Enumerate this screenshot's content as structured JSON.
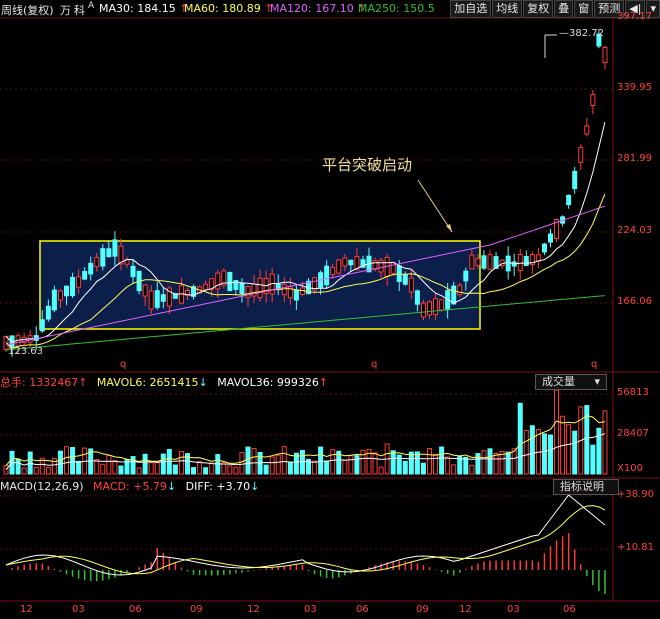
{
  "topbar": {
    "period_label": "周线(复权)",
    "wan_label": "万",
    "ke_label": "科",
    "a_label": "A",
    "ma30": "MA30: 184.15",
    "ma60": "MA60: 180.89",
    "ma120": "MA120: 167.10",
    "ma250": "MA250: 150.5",
    "buttons": [
      "加自选",
      "均线",
      "复权",
      "叠",
      "窗",
      "预测"
    ],
    "arrow_label": "◀|",
    "dropdown_label": "▾"
  },
  "annotation": {
    "text": "平台突破启动"
  },
  "price_axis": {
    "ticks": [
      "397.17",
      "339.95",
      "281.99",
      "224.03",
      "166.06"
    ]
  },
  "price_marks": {
    "high": "382.72",
    "low": "123.63",
    "q_markers": [
      "q",
      "q",
      "q"
    ]
  },
  "volume_panel": {
    "total_label": "总手: 1332467",
    "mavol6": "MAVOL6: 2651415",
    "mavol36": "MAVOL36: 999326",
    "button": "成交量",
    "ticks": [
      "56813",
      "28407",
      "X100"
    ]
  },
  "macd_panel": {
    "title": "MACD(12,26,9)",
    "macd": "MACD: +5.79",
    "diff": "DIFF: +3.70",
    "button": "指标说明",
    "ticks": [
      "+38.90",
      "+10.81"
    ]
  },
  "x_axis": {
    "labels": [
      "12",
      "03",
      "06",
      "09",
      "12",
      "03",
      "06",
      "09",
      "12",
      "03",
      "06"
    ]
  },
  "colors": {
    "up": "#ff3b3b",
    "down": "#54ffff",
    "ma30": "#ffffff",
    "ma60": "#ffff55",
    "ma120": "#e060ff",
    "ma250": "#30c030",
    "accent_yellow": "#ffff00",
    "box_fill": "#0b1f4a"
  }
}
